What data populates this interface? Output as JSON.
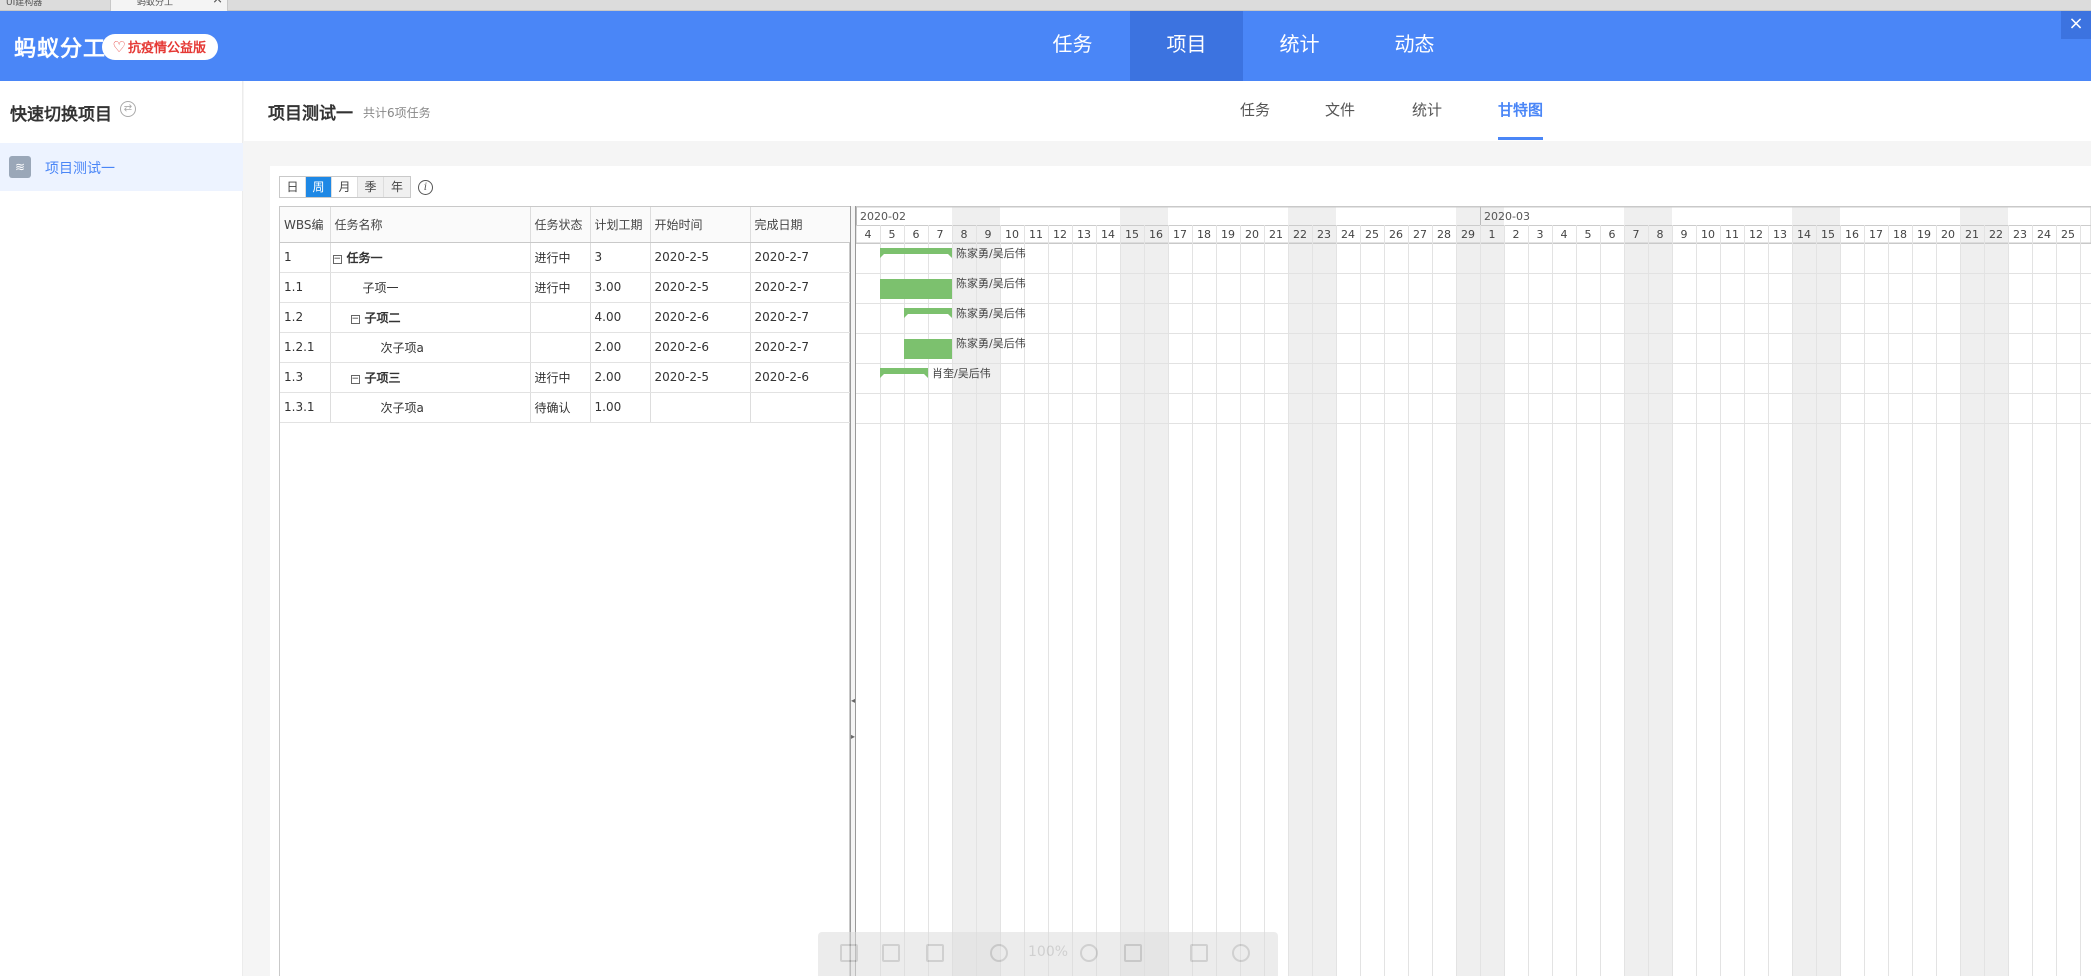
{
  "browser": {
    "tabs": [
      {
        "label": "UI建构器"
      },
      {
        "label": "蚂蚁分工"
      }
    ],
    "close_label": "×"
  },
  "header": {
    "brand": "蚂蚁分工",
    "badge": "抗疫情公益版",
    "nav": [
      {
        "label": "任务",
        "active": false
      },
      {
        "label": "项目",
        "active": true
      },
      {
        "label": "统计",
        "active": false
      },
      {
        "label": "动态",
        "active": false
      }
    ],
    "close_label": "×",
    "accent": "#4a86f7"
  },
  "sidebar": {
    "title": "快速切换项目",
    "items": [
      {
        "label": "项目测试一",
        "active": true
      }
    ]
  },
  "project": {
    "title": "项目测试一",
    "count": "共计6项任务",
    "tabs": [
      {
        "label": "任务",
        "active": false
      },
      {
        "label": "文件",
        "active": false
      },
      {
        "label": "统计",
        "active": false
      },
      {
        "label": "甘特图",
        "active": true
      }
    ]
  },
  "view_switch": {
    "options": [
      {
        "label": "日",
        "active": false
      },
      {
        "label": "周",
        "active": true
      },
      {
        "label": "月",
        "active": false
      },
      {
        "label": "季",
        "active": false
      },
      {
        "label": "年",
        "active": false
      }
    ]
  },
  "grid": {
    "columns": [
      "WBS编",
      "任务名称",
      "任务状态",
      "计划工期",
      "开始时间",
      "完成日期"
    ],
    "rows": [
      {
        "wbs": "1",
        "name": "任务一",
        "level": 0,
        "toggle": true,
        "bold": true,
        "status": "进行中",
        "duration": "3",
        "start": "2020-2-5",
        "end": "2020-2-7"
      },
      {
        "wbs": "1.1",
        "name": "子项一",
        "level": 1,
        "toggle": false,
        "bold": false,
        "status": "进行中",
        "duration": "3.00",
        "start": "2020-2-5",
        "end": "2020-2-7"
      },
      {
        "wbs": "1.2",
        "name": "子项二",
        "level": 1,
        "toggle": true,
        "bold": true,
        "status": "",
        "duration": "4.00",
        "start": "2020-2-6",
        "end": "2020-2-7"
      },
      {
        "wbs": "1.2.1",
        "name": "次子项a",
        "level": 2,
        "toggle": false,
        "bold": false,
        "status": "",
        "duration": "2.00",
        "start": "2020-2-6",
        "end": "2020-2-7"
      },
      {
        "wbs": "1.3",
        "name": "子项三",
        "level": 1,
        "toggle": true,
        "bold": true,
        "status": "进行中",
        "duration": "2.00",
        "start": "2020-2-5",
        "end": "2020-2-6"
      },
      {
        "wbs": "1.3.1",
        "name": "次子项a",
        "level": 2,
        "toggle": false,
        "bold": false,
        "status": "待确认",
        "duration": "1.00",
        "start": "",
        "end": ""
      }
    ]
  },
  "gantt": {
    "months": [
      {
        "label": "2020-02",
        "start_index": 0
      },
      {
        "label": "2020-03",
        "start_index": 26
      }
    ],
    "days": [
      "4",
      "5",
      "6",
      "7",
      "8",
      "9",
      "10",
      "11",
      "12",
      "13",
      "14",
      "15",
      "16",
      "17",
      "18",
      "19",
      "20",
      "21",
      "22",
      "23",
      "24",
      "25",
      "26",
      "27",
      "28",
      "29",
      "1",
      "2",
      "3",
      "4",
      "5",
      "6",
      "7",
      "8",
      "9",
      "10",
      "11",
      "12",
      "13",
      "14",
      "15",
      "16",
      "17",
      "18",
      "19",
      "20",
      "21",
      "22",
      "23",
      "24",
      "25"
    ],
    "weekend_indices": [
      4,
      5,
      11,
      12,
      18,
      19,
      25,
      26,
      32,
      33,
      39,
      40,
      46,
      47
    ],
    "bars": [
      {
        "row": 0,
        "start_index": 1,
        "span": 3,
        "summary": true,
        "label": "陈家勇/吴后伟"
      },
      {
        "row": 1,
        "start_index": 1,
        "span": 3,
        "summary": false,
        "label": "陈家勇/吴后伟"
      },
      {
        "row": 2,
        "start_index": 2,
        "span": 2,
        "summary": true,
        "label": "陈家勇/吴后伟"
      },
      {
        "row": 3,
        "start_index": 2,
        "span": 2,
        "summary": false,
        "label": "陈家勇/吴后伟"
      },
      {
        "row": 4,
        "start_index": 1,
        "span": 2,
        "summary": true,
        "label": "肖奎/吴后伟"
      }
    ],
    "bar_color": "#7cc16e",
    "weekend_color": "#efefef"
  },
  "toolbar": {
    "zoom": "100%"
  }
}
